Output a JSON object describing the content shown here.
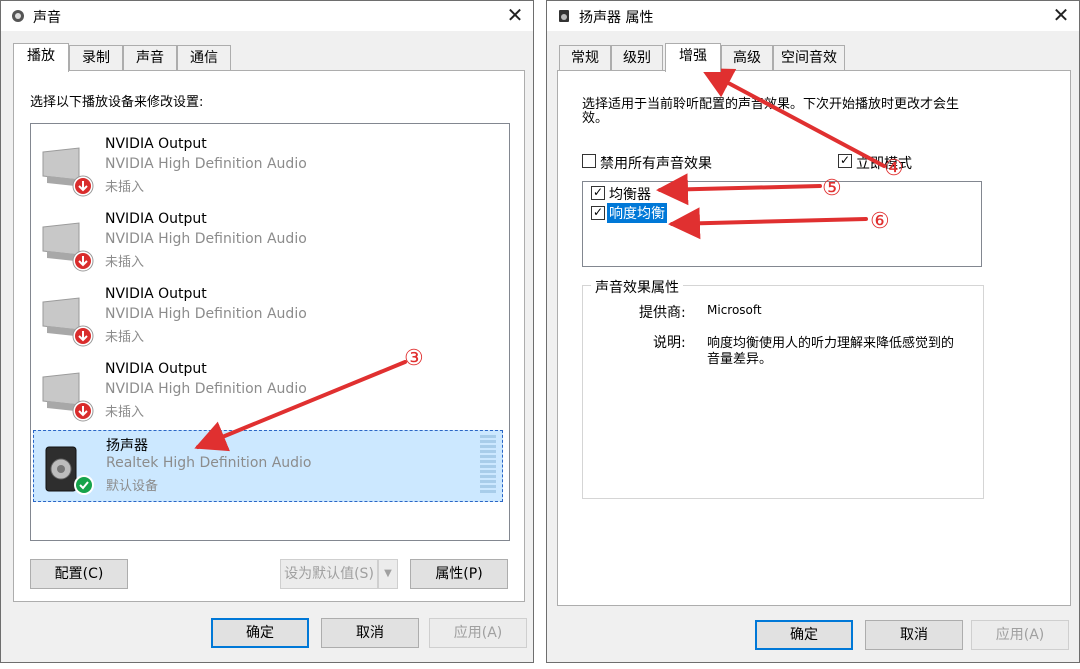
{
  "sound_window": {
    "title": "声音",
    "close_glyph": "✕",
    "tabs": [
      "播放",
      "录制",
      "声音",
      "通信"
    ],
    "instruction": "选择以下播放设备来修改设置:",
    "devices": [
      {
        "name": "NVIDIA Output",
        "driver": "NVIDIA High Definition Audio",
        "status": "未插入"
      },
      {
        "name": "NVIDIA Output",
        "driver": "NVIDIA High Definition Audio",
        "status": "未插入"
      },
      {
        "name": "NVIDIA Output",
        "driver": "NVIDIA High Definition Audio",
        "status": "未插入"
      },
      {
        "name": "NVIDIA Output",
        "driver": "NVIDIA High Definition Audio",
        "status": "未插入"
      },
      {
        "name": "扬声器",
        "driver": "Realtek High Definition Audio",
        "status": "默认设备"
      }
    ],
    "configure_button": "配置(C)",
    "set_default_button": "设为默认值(S)",
    "properties_button": "属性(P)",
    "ok_button": "确定",
    "cancel_button": "取消",
    "apply_button": "应用(A)"
  },
  "properties_window": {
    "title": "扬声器 属性",
    "close_glyph": "✕",
    "tabs": [
      "常规",
      "级别",
      "增强",
      "高级",
      "空间音效"
    ],
    "description_line1": "选择适用于当前聆听配置的声音效果。下次开始播放时更改才会生",
    "description_line2": "效。",
    "disable_all_label": "禁用所有声音效果",
    "immediate_mode_label": "立即模式",
    "effects": [
      {
        "label": "均衡器",
        "checked": true
      },
      {
        "label": "响度均衡",
        "checked": true
      }
    ],
    "group_title": "声音效果属性",
    "provider_label": "提供商:",
    "provider_value": "Microsoft",
    "desc_label": "说明:",
    "desc_value_line1": "响度均衡使用人的听力理解来降低感觉到的",
    "desc_value_line2": "音量差异。",
    "ok_button": "确定",
    "cancel_button": "取消",
    "apply_button": "应用(A)"
  },
  "annotations": [
    "③",
    "④",
    "⑤",
    "⑥"
  ],
  "colors": {
    "arrow": "#e03030",
    "selection": "#cce8ff",
    "highlight": "#0078d7",
    "ok_green": "#16a34a",
    "unplugged_red": "#d92c2c"
  }
}
